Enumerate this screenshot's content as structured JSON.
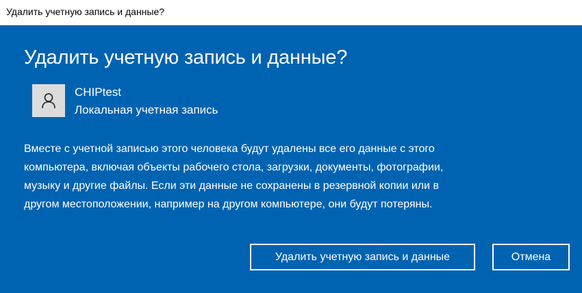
{
  "window": {
    "title": "Удалить учетную запись и данные?"
  },
  "dialog": {
    "heading": "Удалить учетную запись и данные?",
    "account": {
      "name": "CHIPtest",
      "type": "Локальная учетная запись",
      "avatar_icon": "user-icon"
    },
    "message_lines": [
      "Вместе с учетной записью этого человека будут удалены все его данные с этого",
      "компьютера, включая объекты рабочего стола, загрузки, документы, фотографии,",
      "музыку и другие файлы. Если эти данные не сохранены в резервной копии или в",
      "другом местоположении, например на другом компьютере, они будут потеряны."
    ],
    "buttons": {
      "delete_label": "Удалить учетную запись и данные",
      "cancel_label": "Отмена"
    }
  },
  "colors": {
    "background": "#0063b1",
    "titlebar": "#ffffff",
    "text": "#ffffff",
    "avatar_bg": "#dcdcdc"
  }
}
